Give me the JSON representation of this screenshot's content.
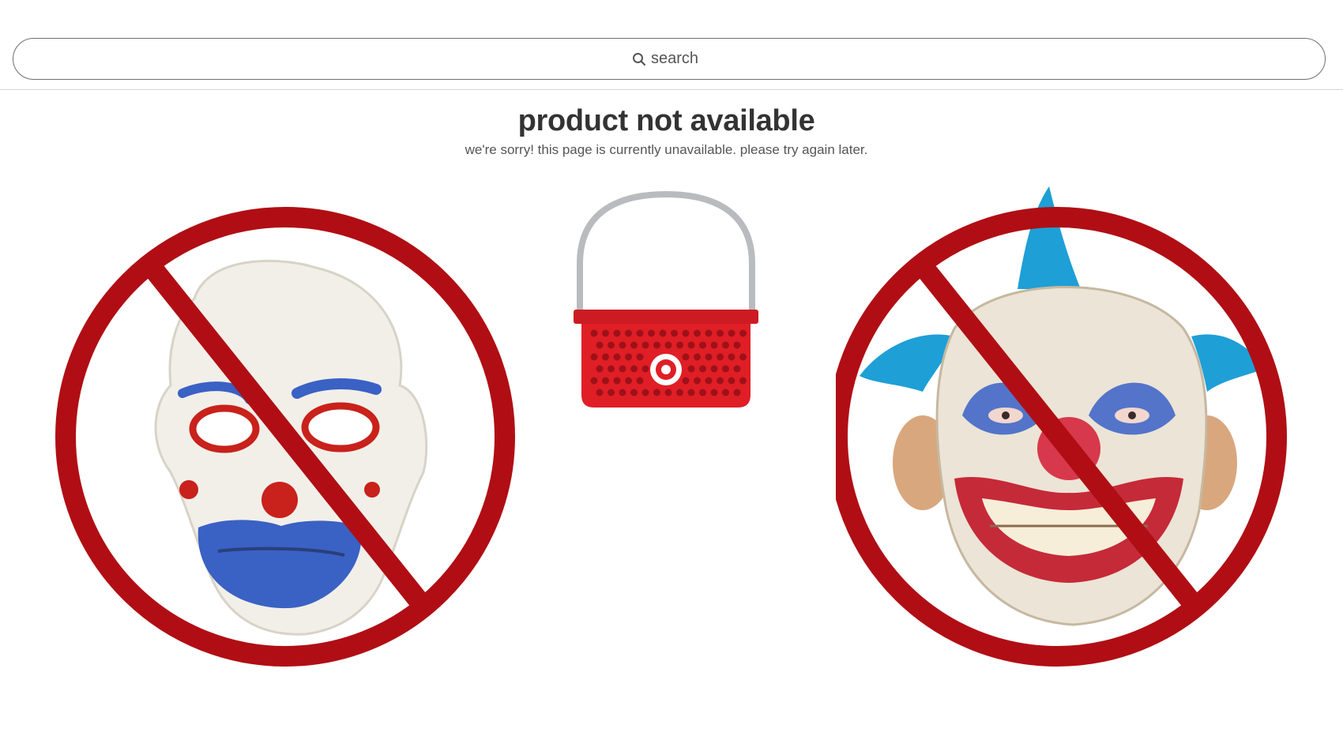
{
  "search": {
    "placeholder": "search",
    "icon": "search-icon"
  },
  "main": {
    "title": "product not available",
    "subtitle": "we're sorry! this page is currently unavailable. please try again later."
  },
  "illustration": {
    "basket_icon": "shopping-basket-icon",
    "basket_color": "#e01e26",
    "handle_color": "#b9bbbe"
  },
  "images": {
    "left": "prohibited-clown-mask-sad-left",
    "right": "prohibited-clown-mask-scary-right",
    "prohibition_color": "#b00e14"
  }
}
